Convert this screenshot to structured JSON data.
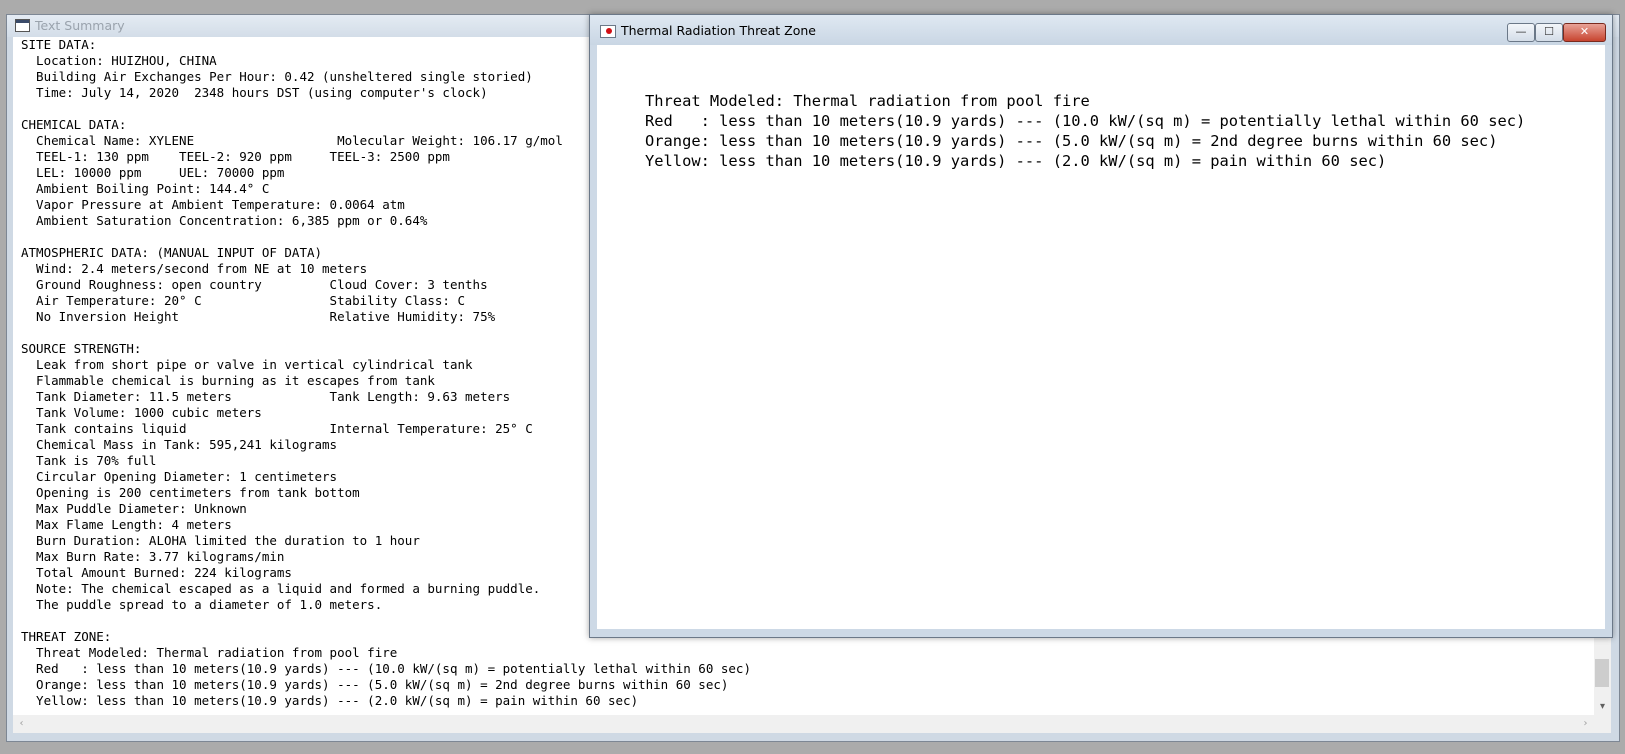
{
  "text_summary": {
    "title": "Text Summary",
    "lines": [
      "SITE DATA:",
      "  Location: HUIZHOU, CHINA",
      "  Building Air Exchanges Per Hour: 0.42 (unsheltered single storied)",
      "  Time: July 14, 2020  2348 hours DST (using computer's clock)",
      "",
      "CHEMICAL DATA:",
      "  Chemical Name: XYLENE                   Molecular Weight: 106.17 g/mol",
      "  TEEL-1: 130 ppm    TEEL-2: 920 ppm     TEEL-3: 2500 ppm",
      "  LEL: 10000 ppm     UEL: 70000 ppm",
      "  Ambient Boiling Point: 144.4° C",
      "  Vapor Pressure at Ambient Temperature: 0.0064 atm",
      "  Ambient Saturation Concentration: 6,385 ppm or 0.64%",
      "",
      "ATMOSPHERIC DATA: (MANUAL INPUT OF DATA)",
      "  Wind: 2.4 meters/second from NE at 10 meters",
      "  Ground Roughness: open country         Cloud Cover: 3 tenths",
      "  Air Temperature: 20° C                 Stability Class: C",
      "  No Inversion Height                    Relative Humidity: 75%",
      "",
      "SOURCE STRENGTH:",
      "  Leak from short pipe or valve in vertical cylindrical tank",
      "  Flammable chemical is burning as it escapes from tank",
      "  Tank Diameter: 11.5 meters             Tank Length: 9.63 meters",
      "  Tank Volume: 1000 cubic meters",
      "  Tank contains liquid                   Internal Temperature: 25° C",
      "  Chemical Mass in Tank: 595,241 kilograms",
      "  Tank is 70% full",
      "  Circular Opening Diameter: 1 centimeters",
      "  Opening is 200 centimeters from tank bottom",
      "  Max Puddle Diameter: Unknown",
      "  Max Flame Length: 4 meters",
      "  Burn Duration: ALOHA limited the duration to 1 hour",
      "  Max Burn Rate: 3.77 kilograms/min",
      "  Total Amount Burned: 224 kilograms",
      "  Note: The chemical escaped as a liquid and formed a burning puddle.",
      "  The puddle spread to a diameter of 1.0 meters.",
      "",
      "THREAT ZONE:",
      "  Threat Modeled: Thermal radiation from pool fire",
      "  Red   : less than 10 meters(10.9 yards) --- (10.0 kW/(sq m) = potentially lethal within 60 sec)",
      "  Orange: less than 10 meters(10.9 yards) --- (5.0 kW/(sq m) = 2nd degree burns within 60 sec)",
      "  Yellow: less than 10 meters(10.9 yards) --- (2.0 kW/(sq m) = pain within 60 sec)"
    ]
  },
  "threat_window": {
    "title": "Thermal Radiation Threat Zone",
    "lines": [
      "Threat Modeled: Thermal radiation from pool fire",
      "Red   : less than 10 meters(10.9 yards) --- (10.0 kW/(sq m) = potentially lethal within 60 sec)",
      "Orange: less than 10 meters(10.9 yards) --- (5.0 kW/(sq m) = 2nd degree burns within 60 sec)",
      "Yellow: less than 10 meters(10.9 yards) --- (2.0 kW/(sq m) = pain within 60 sec)"
    ],
    "controls": {
      "minimize": "—",
      "maximize": "☐",
      "close": "✕"
    }
  },
  "scroll": {
    "down_arrow": "▾",
    "left_arrow": "‹",
    "right_arrow": "›"
  }
}
